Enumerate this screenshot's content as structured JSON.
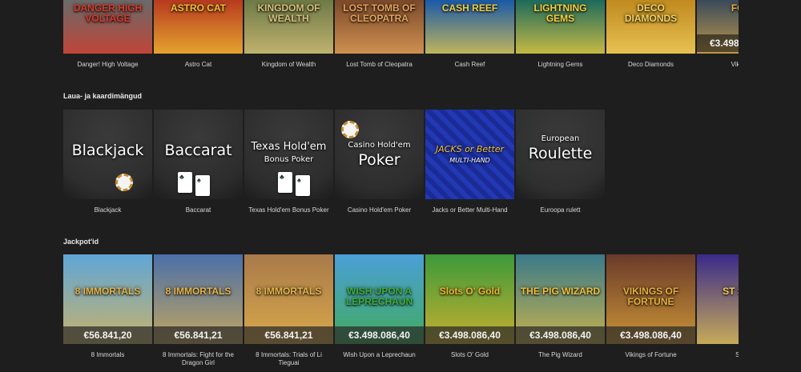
{
  "sections": {
    "top": {
      "games": [
        {
          "name": "Danger! High Voltage",
          "logo": "DANGER HIGH VOLTAGE",
          "bg": "#6a6a6a",
          "accent": "#d93a2a",
          "jackpot": ""
        },
        {
          "name": "Astro Cat",
          "logo": "ASTRO CAT",
          "bg": "#b73a1f",
          "accent": "#f2c233",
          "jackpot": ""
        },
        {
          "name": "Kingdom of Wealth",
          "logo": "KINGDOM OF WEALTH",
          "bg": "#6d7a46",
          "accent": "#d8c27a",
          "jackpot": ""
        },
        {
          "name": "Lost Tomb of Cleopatra",
          "logo": "LOST TOMB OF CLEOPATRA",
          "bg": "#7c4a2b",
          "accent": "#e7a45b",
          "jackpot": ""
        },
        {
          "name": "Cash Reef",
          "logo": "CASH REEF",
          "bg": "#1a5aa8",
          "accent": "#f0d046",
          "jackpot": ""
        },
        {
          "name": "Lightning Gems",
          "logo": "LIGHTNING GEMS",
          "bg": "#1d6a5c",
          "accent": "#f7d13c",
          "jackpot": ""
        },
        {
          "name": "Deco Diamonds",
          "logo": "DECO DIAMONDS",
          "bg": "#c08a1f",
          "accent": "#f3d262",
          "jackpot": ""
        },
        {
          "name": "Vikings",
          "logo": "FOR",
          "bg": "#3a4a5a",
          "accent": "#e6b045",
          "jackpot": "€3.498"
        }
      ]
    },
    "table": {
      "title": "Laua- ja kaardimängud",
      "games": [
        {
          "name": "Blackjack",
          "logo": "Blackjack",
          "sub": "",
          "bg": "#2e2e2e"
        },
        {
          "name": "Baccarat",
          "logo": "Baccarat",
          "sub": "",
          "bg": "#2c2c2c"
        },
        {
          "name": "Texas Hold'em Bonus Poker",
          "logo": "Texas Hold'em",
          "sub": "Bonus Poker",
          "bg": "#2d2d2d"
        },
        {
          "name": "Casino Hold'em Poker",
          "logo": "Poker",
          "sub": "Casino Hold'em",
          "bg": "#2d2d2d"
        },
        {
          "name": "Jacks or Better Multi-Hand",
          "logo": "JACKS or Better",
          "sub": "MULTI-HAND",
          "bg": "#1b2f9a"
        },
        {
          "name": "Euroopa rulett",
          "logo": "Roulette",
          "sub": "European",
          "bg": "#2f2f2f"
        }
      ]
    },
    "jackpots": {
      "title": "Jackpot'id",
      "games": [
        {
          "name": "8 Immortals",
          "logo": "8 IMMORTALS",
          "bg": "#5fa6d8",
          "accent": "#e7b64a",
          "jackpot": "€56.841,20"
        },
        {
          "name": "8 Immortals: Fight for the Dragon Girl",
          "logo": "8 IMMORTALS",
          "bg": "#4a6fa8",
          "accent": "#e7b64a",
          "jackpot": "€56.841,21"
        },
        {
          "name": "8 Immortals: Trials of Li Tieguai",
          "logo": "8 IMMORTALS",
          "bg": "#a87a4a",
          "accent": "#e7b64a",
          "jackpot": "€56.841,21"
        },
        {
          "name": "Wish Upon a Leprechaun",
          "logo": "WISH UPON A LEPRECHAUN",
          "bg": "#4a9fd8",
          "accent": "#3fae3a",
          "jackpot": "€3.498.086,40"
        },
        {
          "name": "Slots O' Gold",
          "logo": "Slots O' Gold",
          "bg": "#3c9a3a",
          "accent": "#f2b52c",
          "jackpot": "€3.498.086,40"
        },
        {
          "name": "The Pig Wizard",
          "logo": "THE PIG WIZARD",
          "bg": "#3a7a8a",
          "accent": "#f0c23a",
          "jackpot": "€3.498.086,40"
        },
        {
          "name": "Vikings of Fortune",
          "logo": "VIKINGS OF FORTUNE",
          "bg": "#6a3a2a",
          "accent": "#e8b03a",
          "jackpot": "€3.498.086,40"
        },
        {
          "name": "Star",
          "logo": "ST SPIN",
          "bg": "#3a2a8a",
          "accent": "#f0d04a",
          "jackpot": ""
        }
      ]
    }
  }
}
